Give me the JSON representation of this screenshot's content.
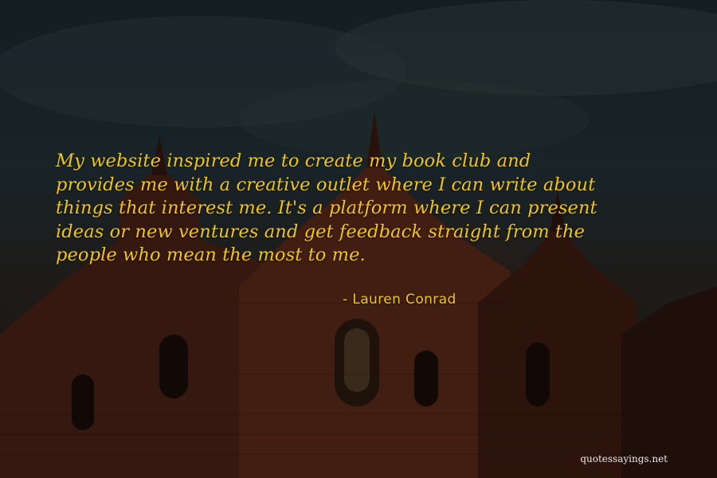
{
  "quote": {
    "lines": [
      "My website inspired me to create my book club and",
      "provides me with a creative outlet where I can write about",
      "things that interest me. It's a platform where I can present",
      "ideas or new ventures and get feedback straight from the",
      "people who mean the most to me."
    ],
    "author": "- Lauren Conrad",
    "text_color": "#f0c419"
  },
  "watermark": "quotessayings.net"
}
